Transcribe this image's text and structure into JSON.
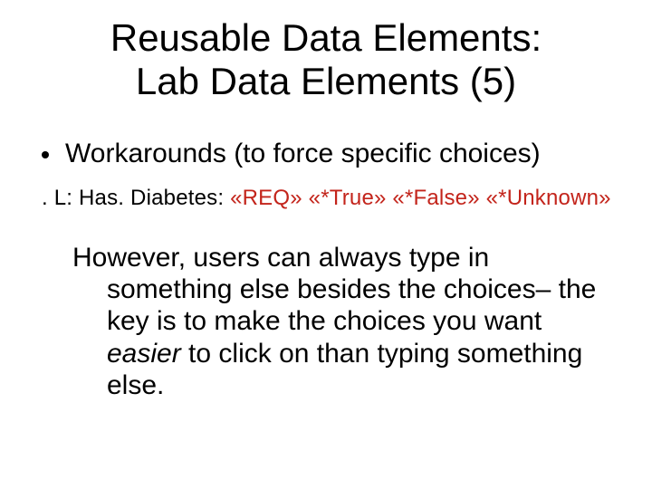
{
  "title_line1": "Reusable Data Elements:",
  "title_line2": "Lab Data Elements (5)",
  "bullet1": "Workarounds (to force specific choices)",
  "code_prefix": ". L: Has. Diabetes: ",
  "code_tokens": "«REQ»  «*True»  «*False»  «*Unknown»",
  "para_lead": "However, users can always type in something else besides the choices– the key is to make the choices you want ",
  "para_ital": "easier",
  "para_tail": " to click on than typing something else."
}
